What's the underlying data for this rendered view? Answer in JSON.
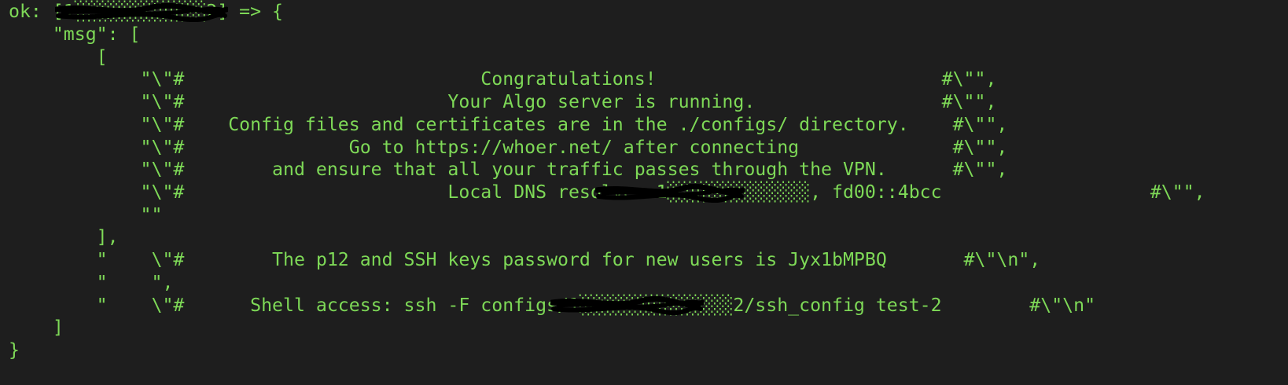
{
  "terminal": {
    "colors": {
      "background": "#1e1e1e",
      "text": "#7ed957",
      "redaction": "#000000"
    },
    "lines": [
      "ok: [1░░░░░░░░░░░░2] => {",
      "    \"msg\": [",
      "        [",
      "            \"\\\"#                           Congratulations!                          #\\\"\",",
      "            \"\\\"#                        Your Algo server is running.                 #\\\"\",",
      "            \"\\\"#    Config files and certificates are in the ./configs/ directory.    #\\\"\",",
      "            \"\\\"#               Go to https://whoer.net/ after connecting              #\\\"\",",
      "            \"\\\"#        and ensure that all your traffic passes through the VPN.      #\\\"\",",
      "            \"\\\"#                        Local DNS resolver 1░░░░░░░░░░░░░, fd00::4bcc                   #\\\"\",",
      "            \"\"",
      "        ],",
      "        \"    \\\"#        The p12 and SSH keys password for new users is Jyx1bMPBQ       #\\\"\\n\",",
      "        \"    \",",
      "        \"    \\\"#      Shell access: ssh -F configs/1░░░░░░░░░░░░░░2/ssh_config test-2        #\\\"\\n\"",
      "    ]",
      "}"
    ]
  }
}
